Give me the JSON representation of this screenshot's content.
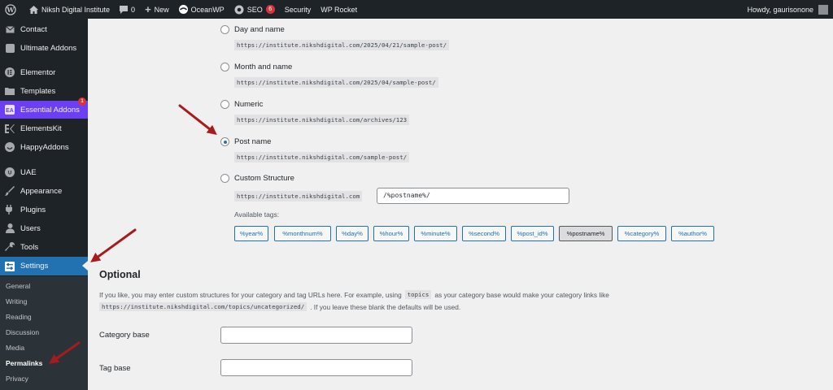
{
  "admin_bar": {
    "site_name": "Niksh Digital Institute",
    "comments_count": "0",
    "new_label": "New",
    "oceanwp_label": "OceanWP",
    "seo_label": "SEO",
    "seo_badge": "6",
    "security_label": "Security",
    "wprocket_label": "WP Rocket",
    "howdy": "Howdy, gaurisonone"
  },
  "sidebar": {
    "items": [
      {
        "label": "Contact",
        "icon": "mail-icon"
      },
      {
        "label": "Ultimate Addons",
        "icon": "addons-icon"
      },
      {
        "label": "Elementor",
        "icon": "elementor-icon"
      },
      {
        "label": "Templates",
        "icon": "folder-icon"
      },
      {
        "label": "Essential Addons",
        "icon": "ea-icon",
        "badge": "1"
      },
      {
        "label": "ElementsKit",
        "icon": "ek-icon"
      },
      {
        "label": "HappyAddons",
        "icon": "happy-icon"
      },
      {
        "label": "UAE",
        "icon": "uae-icon"
      },
      {
        "label": "Appearance",
        "icon": "brush-icon"
      },
      {
        "label": "Plugins",
        "icon": "plug-icon"
      },
      {
        "label": "Users",
        "icon": "user-icon"
      },
      {
        "label": "Tools",
        "icon": "wrench-icon"
      },
      {
        "label": "Settings",
        "icon": "settings-icon"
      }
    ],
    "submenu": [
      "General",
      "Writing",
      "Reading",
      "Discussion",
      "Media",
      "Permalinks",
      "Privacy"
    ]
  },
  "permalinks": {
    "options": [
      {
        "label": "Day and name",
        "example": "https://institute.nikshdigital.com/2025/04/21/sample-post/",
        "checked": false
      },
      {
        "label": "Month and name",
        "example": "https://institute.nikshdigital.com/2025/04/sample-post/",
        "checked": false
      },
      {
        "label": "Numeric",
        "example": "https://institute.nikshdigital.com/archives/123",
        "checked": false
      },
      {
        "label": "Post name",
        "example": "https://institute.nikshdigital.com/sample-post/",
        "checked": true
      },
      {
        "label": "Custom Structure",
        "checked": false
      }
    ],
    "custom_prefix": "https://institute.nikshdigital.com",
    "custom_value": "/%postname%/",
    "available_tags_label": "Available tags:",
    "tags": [
      "%year%",
      "%monthnum%",
      "%day%",
      "%hour%",
      "%minute%",
      "%second%",
      "%post_id%",
      "%postname%",
      "%category%",
      "%author%"
    ],
    "active_tag": "%postname%"
  },
  "optional": {
    "title": "Optional",
    "desc_line1_before": "If you like, you may enter custom structures for your category and tag URLs here. For example, using",
    "desc_code1": "topics",
    "desc_line1_after": "as your category base would make your category links like",
    "desc_code2": "https://institute.nikshdigital.com/topics/uncategorized/",
    "desc_line2_after": ". If you leave these blank the defaults will be used.",
    "category_base_label": "Category base",
    "tag_base_label": "Tag base",
    "category_base_value": "",
    "tag_base_value": ""
  },
  "colors": {
    "admin_dark": "#1d2327",
    "accent": "#2271b1",
    "essential_addons": "#6c3ef4",
    "annotation_arrow": "#a61b1b"
  }
}
